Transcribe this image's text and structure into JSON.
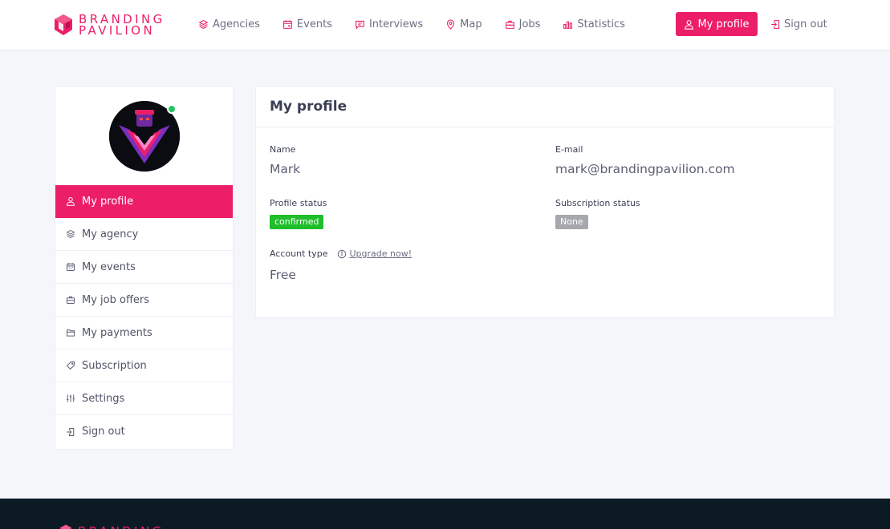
{
  "brand": {
    "line1": "BRANDING",
    "line2": "PAVILION",
    "color": "#ec1e68"
  },
  "nav": {
    "items": [
      {
        "label": "Agencies",
        "icon": "layers-icon"
      },
      {
        "label": "Events",
        "icon": "calendar-icon"
      },
      {
        "label": "Interviews",
        "icon": "chat-icon"
      },
      {
        "label": "Map",
        "icon": "map-pin-icon"
      },
      {
        "label": "Jobs",
        "icon": "briefcase-icon"
      },
      {
        "label": "Statistics",
        "icon": "bar-chart-icon"
      }
    ],
    "profile_button": "My profile",
    "signout": "Sign out"
  },
  "sidebar": {
    "items": [
      {
        "label": "My profile",
        "icon": "user-icon",
        "active": true
      },
      {
        "label": "My agency",
        "icon": "layers-icon"
      },
      {
        "label": "My events",
        "icon": "calendar-icon"
      },
      {
        "label": "My job offers",
        "icon": "briefcase-icon"
      },
      {
        "label": "My payments",
        "icon": "folder-icon"
      },
      {
        "label": "Subscription",
        "icon": "tag-icon"
      },
      {
        "label": "Settings",
        "icon": "sliders-icon"
      },
      {
        "label": "Sign out",
        "icon": "sign-out-icon"
      }
    ]
  },
  "profile": {
    "title": "My profile",
    "name_label": "Name",
    "name_value": "Mark",
    "email_label": "E-mail",
    "email_value": "mark@brandingpavilion.com",
    "profile_status_label": "Profile status",
    "profile_status_value": "confirmed",
    "subscription_status_label": "Subscription status",
    "subscription_status_value": "None",
    "account_type_label": "Account type",
    "upgrade_link": "Upgrade now!",
    "account_type_value": "Free"
  },
  "colors": {
    "accent": "#ec1e68",
    "confirmed": "#1fbe2a",
    "none_badge": "#a6a8ad",
    "online": "#22c55e",
    "footer": "#0c1a24"
  }
}
